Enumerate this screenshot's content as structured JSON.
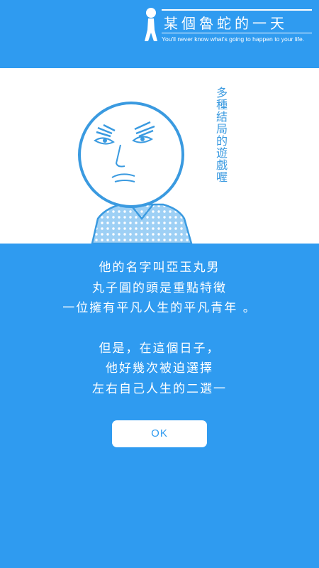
{
  "header": {
    "app_title": "某個魯蛇的一天",
    "tagline": "You'll never know what's going to happen to your life."
  },
  "illustration": {
    "caption": "多種結局的遊戲喔"
  },
  "story": {
    "lines": [
      "他的名字叫亞玉丸男",
      "丸子圓的頭是重點特徵",
      "一位擁有平凡人生的平凡青年 。",
      "",
      "但是，在這個日子，",
      "他好幾次被迫選擇",
      "左右自己人生的二選一"
    ]
  },
  "dialog": {
    "ok_label": "OK"
  },
  "colors": {
    "background": "#2f9bf0",
    "panel": "#ffffff",
    "accent": "#3a9ae0"
  }
}
